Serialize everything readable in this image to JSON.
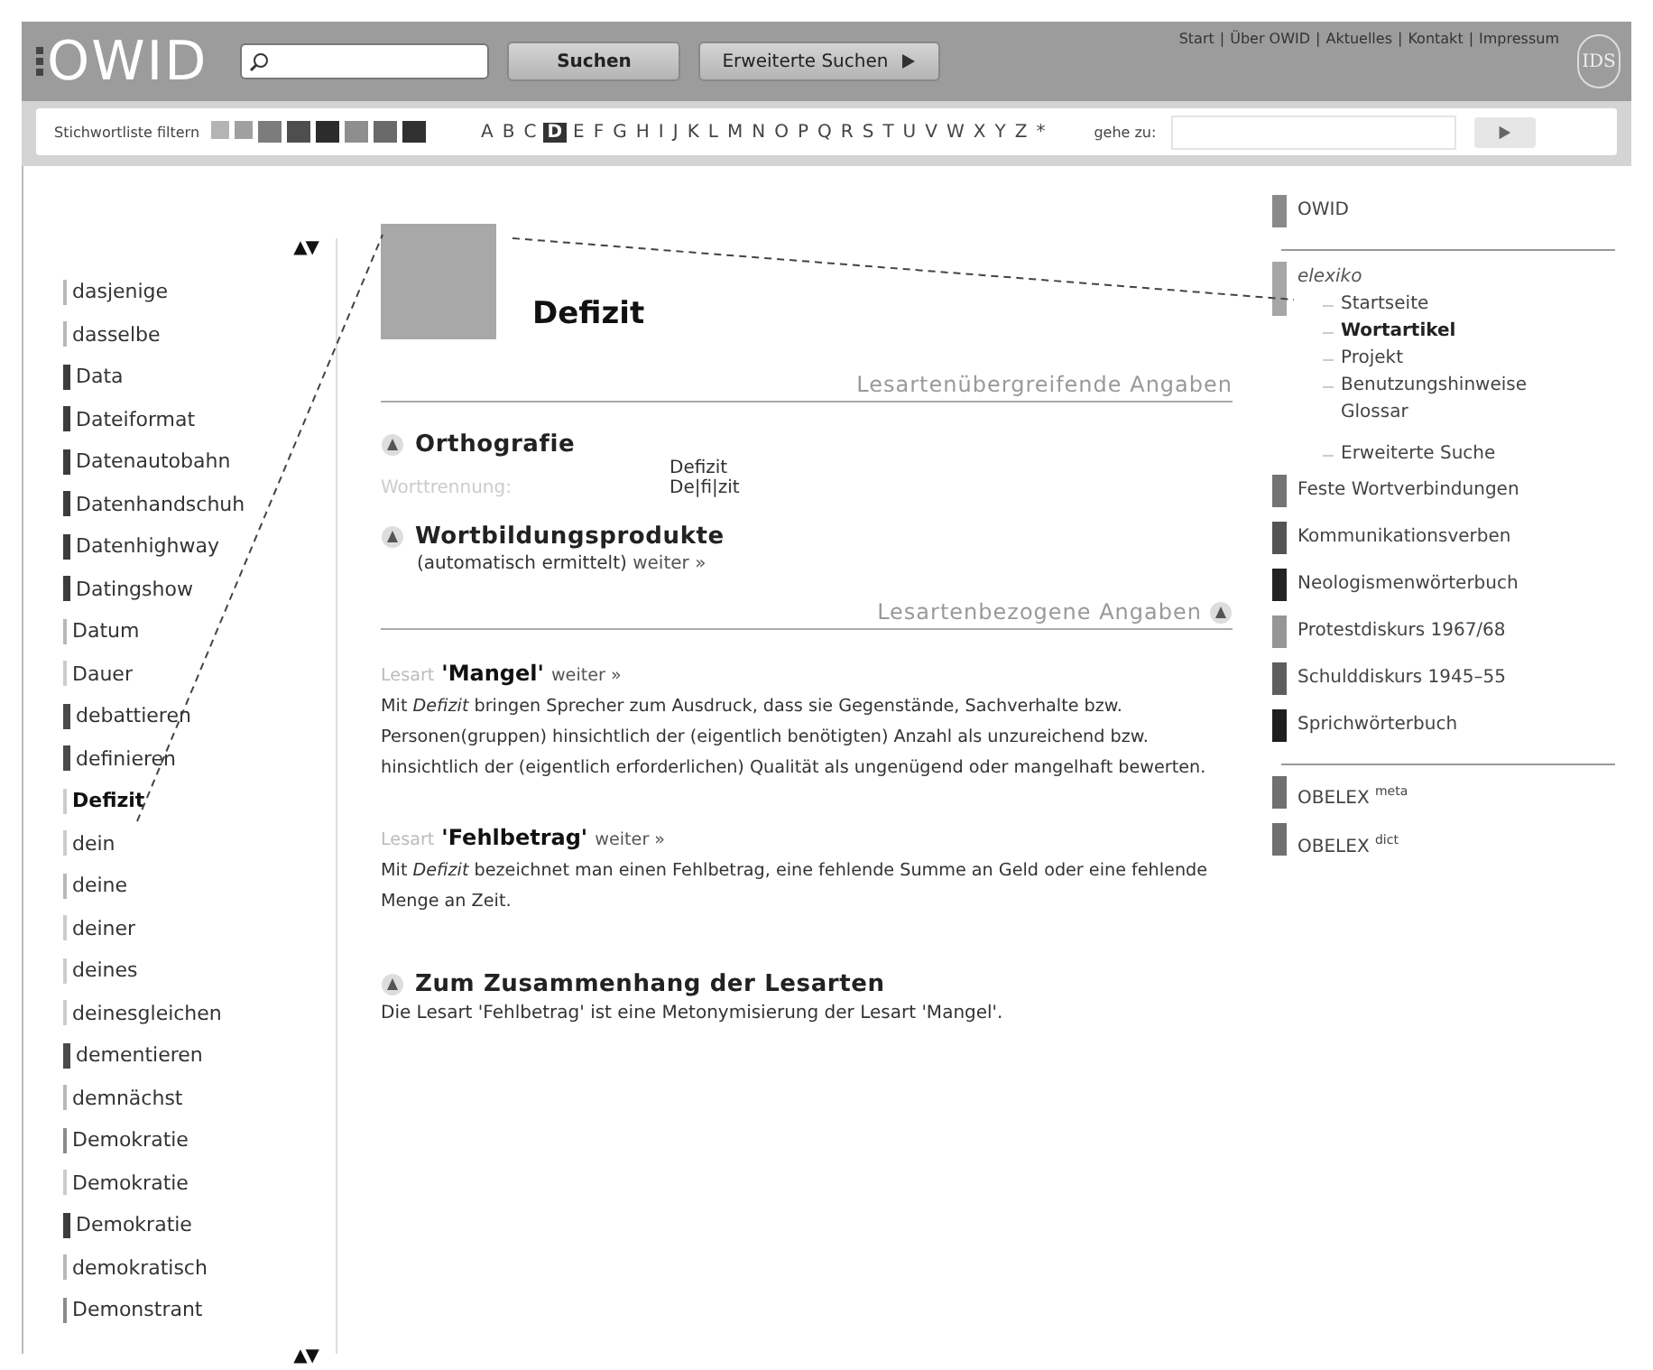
{
  "header": {
    "logo": "OWID",
    "buttons": [
      {
        "label": "Suchen",
        "kind": "plain"
      },
      {
        "label": "Erweiterte Suchen",
        "kind": "arrow"
      }
    ],
    "links": [
      "Start",
      "Über OWID",
      "Aktuelles",
      "Kontakt",
      "Impressum"
    ],
    "separator": "|",
    "emblem": "IDS"
  },
  "filter_bar": {
    "label": "Stichwortliste filtern",
    "swatches": [
      {
        "color": "#b4b4b4"
      },
      {
        "color": "#a0a0a0"
      },
      {
        "color": "#7c7c7c"
      },
      {
        "color": "#4e4e4e"
      },
      {
        "color": "#2c2c2c"
      },
      {
        "color": "#8e8e8e"
      },
      {
        "color": "#6a6a6a"
      },
      {
        "color": "#303030"
      }
    ],
    "letters": [
      {
        "label": "A",
        "selected": false
      },
      {
        "label": "B",
        "selected": false
      },
      {
        "label": "C",
        "selected": false
      },
      {
        "label": "D",
        "selected": true
      },
      {
        "label": "E",
        "selected": false
      },
      {
        "label": "F",
        "selected": false
      },
      {
        "label": "G",
        "selected": false
      },
      {
        "label": "H",
        "selected": false
      },
      {
        "label": "I",
        "selected": false
      },
      {
        "label": "J",
        "selected": false
      },
      {
        "label": "K",
        "selected": false
      },
      {
        "label": "L",
        "selected": false
      },
      {
        "label": "M",
        "selected": false
      },
      {
        "label": "N",
        "selected": false
      },
      {
        "label": "O",
        "selected": false
      },
      {
        "label": "P",
        "selected": false
      },
      {
        "label": "Q",
        "selected": false
      },
      {
        "label": "R",
        "selected": false
      },
      {
        "label": "S",
        "selected": false
      },
      {
        "label": "T",
        "selected": false
      },
      {
        "label": "U",
        "selected": false
      },
      {
        "label": "V",
        "selected": false
      },
      {
        "label": "W",
        "selected": false
      },
      {
        "label": "X",
        "selected": false
      },
      {
        "label": "Y",
        "selected": false
      },
      {
        "label": "Z",
        "selected": false
      },
      {
        "label": "*",
        "selected": false
      }
    ],
    "goto_label": "gehe zu:"
  },
  "word_list": {
    "scroll_arrows_top": "▲▼",
    "scroll_arrows_bottom": "▲▼",
    "items": [
      {
        "label": "dasjenige",
        "color": "#b8b8b8",
        "selected": false
      },
      {
        "label": "dasselbe",
        "color": "#b8b8b8",
        "selected": false
      },
      {
        "label": "Data",
        "color": "#3c3c3c",
        "selected": false
      },
      {
        "label": "Dateiformat",
        "color": "#3c3c3c",
        "selected": false
      },
      {
        "label": "Datenautobahn",
        "color": "#3c3c3c",
        "selected": false
      },
      {
        "label": "Datenhandschuh",
        "color": "#3c3c3c",
        "selected": false
      },
      {
        "label": "Datenhighway",
        "color": "#3c3c3c",
        "selected": false
      },
      {
        "label": "Datingshow",
        "color": "#3c3c3c",
        "selected": false
      },
      {
        "label": "Datum",
        "color": "#b8b8b8",
        "selected": false
      },
      {
        "label": "Dauer",
        "color": "#cccccc",
        "selected": false
      },
      {
        "label": "debattieren",
        "color": "#4a4a4a",
        "selected": false
      },
      {
        "label": "definieren",
        "color": "#4a4a4a",
        "selected": false
      },
      {
        "label": "Defizit",
        "color": "#cccccc",
        "selected": true
      },
      {
        "label": "dein",
        "color": "#cccccc",
        "selected": false
      },
      {
        "label": "deine",
        "color": "#b8b8b8",
        "selected": false
      },
      {
        "label": "deiner",
        "color": "#cccccc",
        "selected": false
      },
      {
        "label": "deines",
        "color": "#cccccc",
        "selected": false
      },
      {
        "label": "deinesgleichen",
        "color": "#cccccc",
        "selected": false
      },
      {
        "label": "dementieren",
        "color": "#4a4a4a",
        "selected": false
      },
      {
        "label": "demnächst",
        "color": "#b8b8b8",
        "selected": false
      },
      {
        "label": "Demokratie",
        "color": "#8c8c8c",
        "selected": false
      },
      {
        "label": "Demokratie",
        "color": "#cccccc",
        "selected": false
      },
      {
        "label": "Demokratie",
        "color": "#3c3c3c",
        "selected": false
      },
      {
        "label": "demokratisch",
        "color": "#b8b8b8",
        "selected": false
      },
      {
        "label": "Demonstrant",
        "color": "#8c8c8c",
        "selected": false
      }
    ]
  },
  "article": {
    "headword": "Defizit",
    "sections": [
      {
        "kind": "heading",
        "title": "Lesartenübergreifende Angaben",
        "icon": false
      },
      {
        "kind": "block",
        "title": "Orthografie",
        "rows": [
          {
            "value": "Defizit"
          },
          {
            "label": "Worttrennung:",
            "value": "De|fi|zit"
          }
        ]
      },
      {
        "kind": "block",
        "title": "Wortbildungsprodukte",
        "note": "(automatisch ermittelt)",
        "link": "weiter »"
      },
      {
        "kind": "heading",
        "title": "Lesartenbezogene Angaben",
        "icon": true
      },
      {
        "kind": "sense",
        "prefix": "Lesart",
        "title": "'Mangel'",
        "link": "weiter »",
        "text": "Mit *Defizit* bringen Sprecher zum Ausdruck, dass sie Gegenstände, Sachverhalte bzw. Personen(gruppen) hinsichtlich der (eigentlich benötigten) Anzahl als unzureichend bzw. hinsichtlich der (eigentlich erforderlichen) Qualität als ungenügend oder mangelhaft bewerten."
      },
      {
        "kind": "sense",
        "prefix": "Lesart",
        "title": "'Fehlbetrag'",
        "link": "weiter »",
        "text": "Mit *Defizit* bezeichnet man einen Fehlbetrag, eine fehlende Summe an Geld oder eine fehlende Menge an Zeit."
      },
      {
        "kind": "block",
        "title": "Zum Zusammenhang der Lesarten",
        "text": "Die Lesart 'Fehlbetrag' ist eine Metonymisierung der Lesart 'Mangel'."
      }
    ]
  },
  "side_nav": {
    "groups": [
      [
        {
          "label": "OWID",
          "color": "#8a8a8a"
        }
      ],
      [
        {
          "label": "elexiko",
          "color": "#a6a6a6",
          "children": [
            {
              "label": "Startseite",
              "selected": false
            },
            {
              "label": "Wortartikel",
              "selected": true
            },
            {
              "label": "Projekt",
              "selected": false
            },
            {
              "label": "Benutzungshinweise Glossar",
              "selected": false
            },
            {
              "label": "Erweiterte Suche",
              "selected": false
            }
          ]
        },
        {
          "label": "Feste Wortverbindungen",
          "color": "#747474"
        },
        {
          "label": "Kommunikationsverben",
          "color": "#545454"
        },
        {
          "label": "Neologismenwörterbuch",
          "color": "#222222"
        },
        {
          "label": "Protestdiskurs 1967/68",
          "color": "#969696"
        },
        {
          "label": "Schulddiskurs 1945–55",
          "color": "#5e5e5e"
        },
        {
          "label": "Sprichwörterbuch",
          "color": "#1e1e1e"
        }
      ],
      [
        {
          "label": "OBELEX $^{meta}$",
          "color": "#707070"
        },
        {
          "label": "OBELEX $^{dict}$",
          "color": "#707070"
        }
      ]
    ]
  }
}
